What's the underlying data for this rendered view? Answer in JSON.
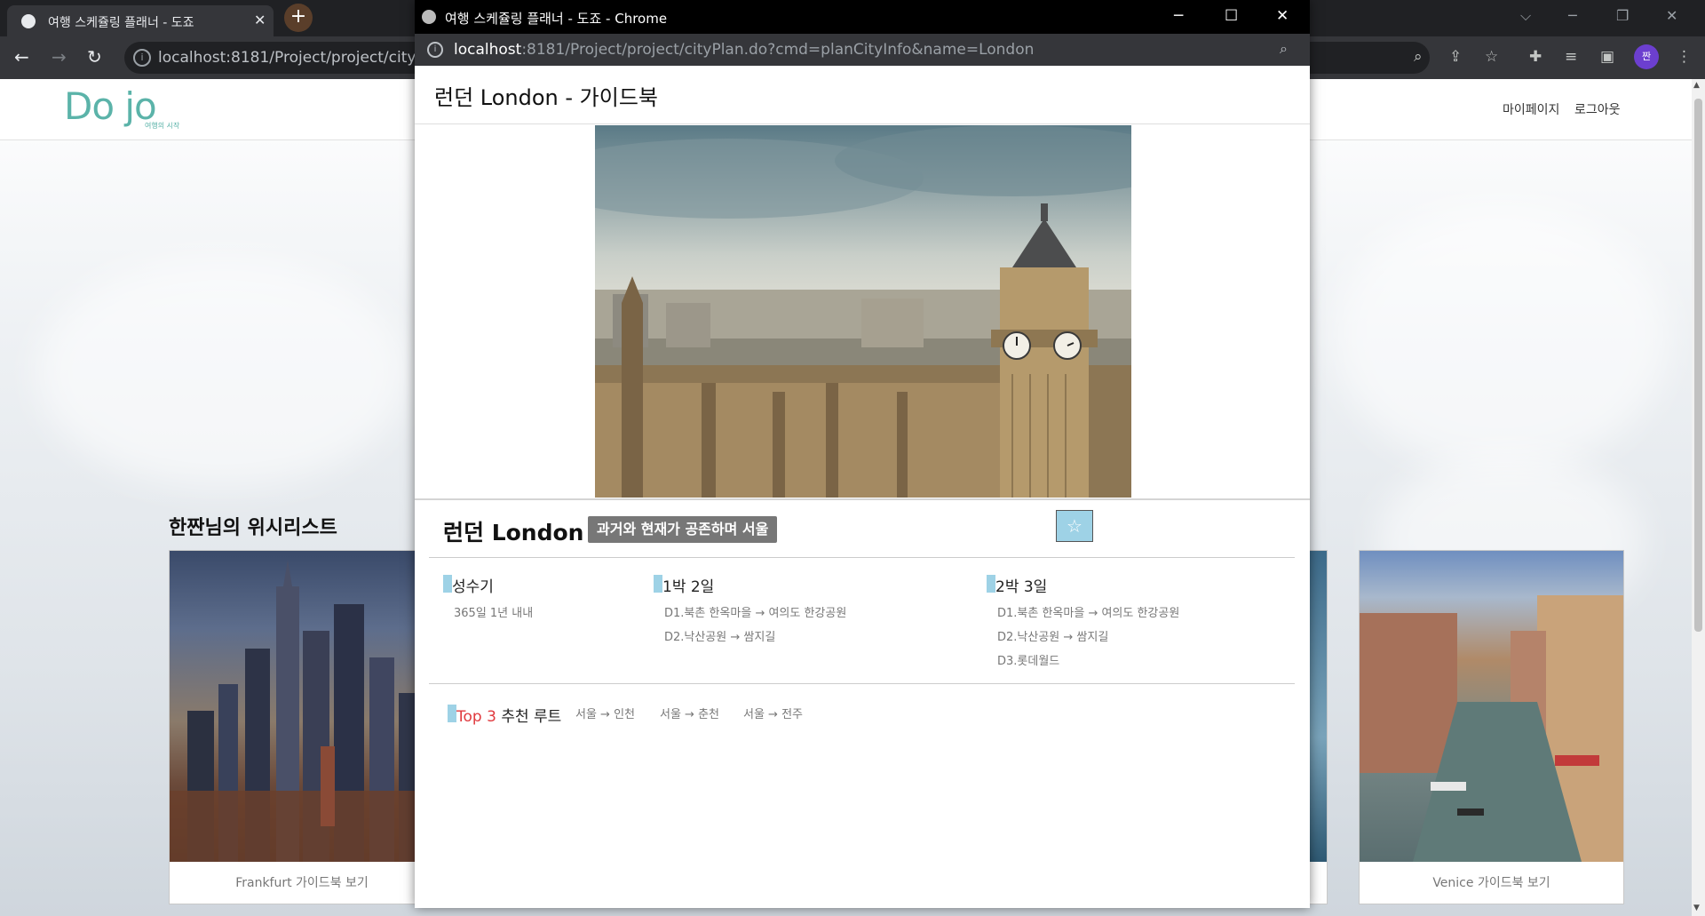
{
  "main_window": {
    "tab_title": "여행 스케쥴링 플래너 - 도죠",
    "tab_close": "✕",
    "new_tab": "+",
    "url": "localhost:8181/Project/project/cityPla",
    "avatar_label": "짠"
  },
  "site": {
    "logo_text": "Do jo",
    "logo_sub": "여행의 시작",
    "nav": {
      "mypage": "마이페이지",
      "logout": "로그아웃"
    }
  },
  "wishlist": {
    "title": "한짠님의 위시리스트",
    "cards": [
      {
        "caption": "Frankfurt 가이드북 보기"
      },
      {
        "caption": "Venice 가이드북 보기"
      }
    ]
  },
  "popup": {
    "window_title": "여행 스케쥴링 플래너 - 도죠 - Chrome",
    "url_host": "localhost",
    "url_rest": ":8181/Project/project/cityPlan.do?cmd=planCityInfo&name=London",
    "heading": "런던 London - 가이드북",
    "city_name": "런던 London",
    "city_tagline": "과거와 현재가 공존하며 서울",
    "star": "☆",
    "sections": [
      {
        "title": "성수기",
        "lines": [
          "365일 1년 내내"
        ]
      },
      {
        "title": "1박 2일",
        "lines": [
          "D1.북촌 한옥마을 → 여의도 한강공원",
          "D2.낙산공원 → 쌈지길"
        ]
      },
      {
        "title": "2박 3일",
        "lines": [
          "D1.북촌 한옥마을 → 여의도 한강공원",
          "D2.낙산공원 → 쌈지길",
          "D3.롯데월드"
        ]
      }
    ],
    "top3": {
      "prefix": "Top 3",
      "label": " 추천 루트"
    },
    "routes": [
      "서울 → 인천",
      "서울 → 춘천",
      "서울 → 전주"
    ]
  },
  "colors": {
    "accent": "#9ed2e6",
    "logo": "#5bb3a9",
    "top3_red": "#e0393e",
    "tag_bg": "#777777"
  }
}
